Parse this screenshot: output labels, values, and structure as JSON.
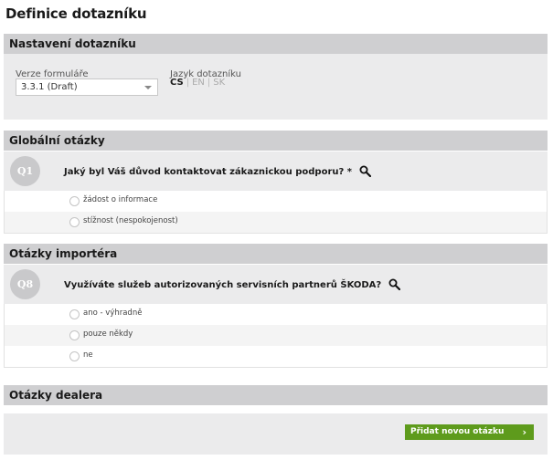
{
  "page": {
    "title": "Definice dotazníku"
  },
  "settings": {
    "header": "Nastavení dotazníku",
    "version_label": "Verze formuláře",
    "version_value": "3.3.1 (Draft)",
    "language_label": "Jazyk dotazníku",
    "languages": [
      {
        "code": "CS",
        "active": true
      },
      {
        "code": "EN",
        "active": false
      },
      {
        "code": "SK",
        "active": false
      }
    ]
  },
  "global": {
    "header": "Globální otázky",
    "question": {
      "badge": "Q1",
      "text": "Jaký byl Váš důvod kontaktovat zákaznickou podporu? *",
      "options": [
        "žádost o informace",
        "stížnost (nespokojenost)"
      ]
    }
  },
  "importer": {
    "header": "Otázky importéra",
    "question": {
      "badge": "Q8",
      "text": "Využíváte služeb autorizovaných servisních partnerů ŠKODA?",
      "options": [
        "ano - výhradně",
        "pouze někdy",
        "ne"
      ]
    }
  },
  "dealer": {
    "header": "Otázky dealera",
    "add_button": "Přidat novou otázku"
  },
  "icons": {
    "search": "magnifier-icon",
    "dropdown": "caret-down-icon",
    "chevron": "chevron-right-icon"
  },
  "colors": {
    "accent_button": "#5e9b1c",
    "section_header": "#cfcfd1",
    "panel": "#ebebec",
    "badge": "#c9c9cb"
  }
}
